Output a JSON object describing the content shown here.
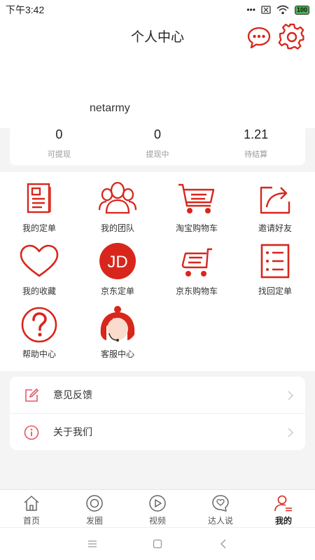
{
  "status_bar": {
    "time": "下午3:42",
    "dots": "•••",
    "battery": "100"
  },
  "header": {
    "title": "个人中心",
    "username": "netarmy"
  },
  "stats": [
    {
      "value": "0",
      "label": "可提现"
    },
    {
      "value": "0",
      "label": "提现中"
    },
    {
      "value": "1.21",
      "label": "待结算"
    }
  ],
  "grid": [
    {
      "label": "我的定单",
      "icon": "document-icon"
    },
    {
      "label": "我的团队",
      "icon": "team-icon"
    },
    {
      "label": "淘宝购物车",
      "icon": "cart-icon"
    },
    {
      "label": "邀请好友",
      "icon": "share-icon"
    },
    {
      "label": "我的收藏",
      "icon": "heart-icon"
    },
    {
      "label": "京东定单",
      "icon": "jd-logo-icon",
      "logo_text": "JD"
    },
    {
      "label": "京东购物车",
      "icon": "jd-cart-icon"
    },
    {
      "label": "找回定单",
      "icon": "list-icon"
    },
    {
      "label": "帮助中心",
      "icon": "help-icon"
    },
    {
      "label": "客服中心",
      "icon": "customer-service-icon"
    }
  ],
  "list": [
    {
      "label": "意见反馈",
      "icon": "edit-icon"
    },
    {
      "label": "关于我们",
      "icon": "info-icon"
    }
  ],
  "tabs": [
    {
      "label": "首页",
      "icon": "home-icon"
    },
    {
      "label": "发圈",
      "icon": "circle-icon"
    },
    {
      "label": "视频",
      "icon": "play-icon"
    },
    {
      "label": "达人说",
      "icon": "chat-heart-icon"
    },
    {
      "label": "我的",
      "icon": "user-icon",
      "active": true
    }
  ],
  "colors": {
    "accent": "#d8261c",
    "accent_light": "#e4576a",
    "background": "#f4f4f4"
  }
}
